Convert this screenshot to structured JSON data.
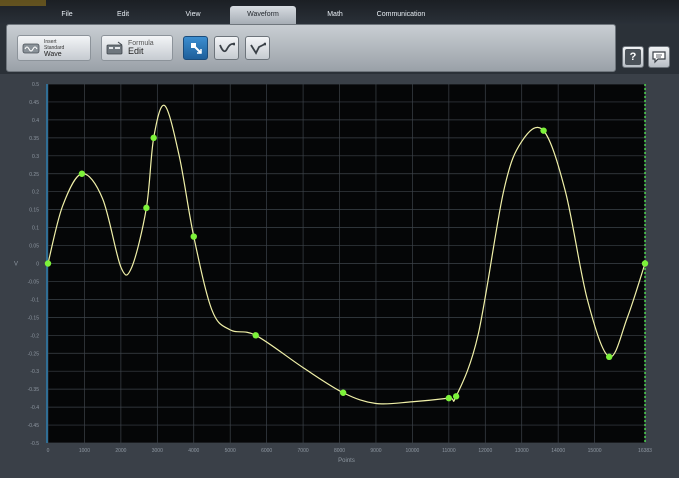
{
  "menu": {
    "tabs": [
      {
        "label": "File",
        "active": false
      },
      {
        "label": "Edit",
        "active": false
      },
      {
        "label": "View",
        "active": false
      },
      {
        "label": "Waveform",
        "active": true
      },
      {
        "label": "Math",
        "active": false
      },
      {
        "label": "Communication",
        "active": false
      }
    ]
  },
  "ribbon": {
    "standard_wave": {
      "line1": "Insert",
      "line2": "Standard",
      "line3": "Wave"
    },
    "formula_edit": {
      "line1": "Formula",
      "line2": "Edit"
    },
    "tools": [
      {
        "name": "select-tool",
        "active": true
      },
      {
        "name": "smooth-curve-tool",
        "active": false
      },
      {
        "name": "line-curve-tool",
        "active": false
      }
    ]
  },
  "corner": {
    "help_symbol": "?",
    "chat_icon": "speech-bubble-icon"
  },
  "colors": {
    "plot_bg": "#050607",
    "grid": "#3d434a",
    "curve": "#f0f0a8",
    "marker": "#7df23a",
    "axis_line": "#2a8cc8",
    "end_marker": "#58ff58"
  },
  "chart_data": {
    "type": "line",
    "xlabel": "Points",
    "ylabel": "V",
    "xlim": [
      0,
      16383
    ],
    "ylim": [
      -0.5,
      0.5
    ],
    "x_ticks": [
      "0",
      "1000",
      "2000",
      "3000",
      "4000",
      "5000",
      "6000",
      "7000",
      "8000",
      "9000",
      "10000",
      "11000",
      "12000",
      "13000",
      "14000",
      "15000",
      "16383"
    ],
    "y_ticks": [
      "0.5",
      "0.45",
      "0.4",
      "0.35",
      "0.3",
      "0.25",
      "0.2",
      "0.15",
      "0.1",
      "0.05",
      "0",
      "-0.05",
      "-0.1",
      "-0.15",
      "-0.2",
      "-0.25",
      "-0.3",
      "-0.35",
      "-0.4",
      "-0.45",
      "-0.5"
    ],
    "control_points": [
      {
        "x": 0,
        "y": 0.0
      },
      {
        "x": 930,
        "y": 0.25
      },
      {
        "x": 2700,
        "y": 0.155
      },
      {
        "x": 2900,
        "y": 0.35
      },
      {
        "x": 4000,
        "y": 0.075
      },
      {
        "x": 5700,
        "y": -0.2
      },
      {
        "x": 8100,
        "y": -0.36
      },
      {
        "x": 11000,
        "y": -0.375
      },
      {
        "x": 11200,
        "y": -0.37
      },
      {
        "x": 13600,
        "y": 0.37
      },
      {
        "x": 15400,
        "y": -0.26
      },
      {
        "x": 16383,
        "y": 0.0
      }
    ],
    "curve": [
      {
        "x": 0,
        "y": 0.0
      },
      {
        "x": 400,
        "y": 0.16
      },
      {
        "x": 930,
        "y": 0.25
      },
      {
        "x": 1500,
        "y": 0.18
      },
      {
        "x": 2000,
        "y": -0.01
      },
      {
        "x": 2300,
        "y": -0.01
      },
      {
        "x": 2700,
        "y": 0.155
      },
      {
        "x": 2900,
        "y": 0.35
      },
      {
        "x": 3200,
        "y": 0.44
      },
      {
        "x": 3600,
        "y": 0.3
      },
      {
        "x": 4000,
        "y": 0.075
      },
      {
        "x": 4500,
        "y": -0.13
      },
      {
        "x": 5000,
        "y": -0.185
      },
      {
        "x": 5700,
        "y": -0.2
      },
      {
        "x": 7000,
        "y": -0.29
      },
      {
        "x": 8100,
        "y": -0.36
      },
      {
        "x": 9000,
        "y": -0.39
      },
      {
        "x": 10000,
        "y": -0.385
      },
      {
        "x": 11000,
        "y": -0.375
      },
      {
        "x": 11200,
        "y": -0.37
      },
      {
        "x": 11800,
        "y": -0.2
      },
      {
        "x": 12500,
        "y": 0.2
      },
      {
        "x": 13000,
        "y": 0.34
      },
      {
        "x": 13600,
        "y": 0.37
      },
      {
        "x": 14200,
        "y": 0.2
      },
      {
        "x": 14800,
        "y": -0.1
      },
      {
        "x": 15400,
        "y": -0.26
      },
      {
        "x": 15900,
        "y": -0.15
      },
      {
        "x": 16383,
        "y": 0.0
      }
    ]
  }
}
